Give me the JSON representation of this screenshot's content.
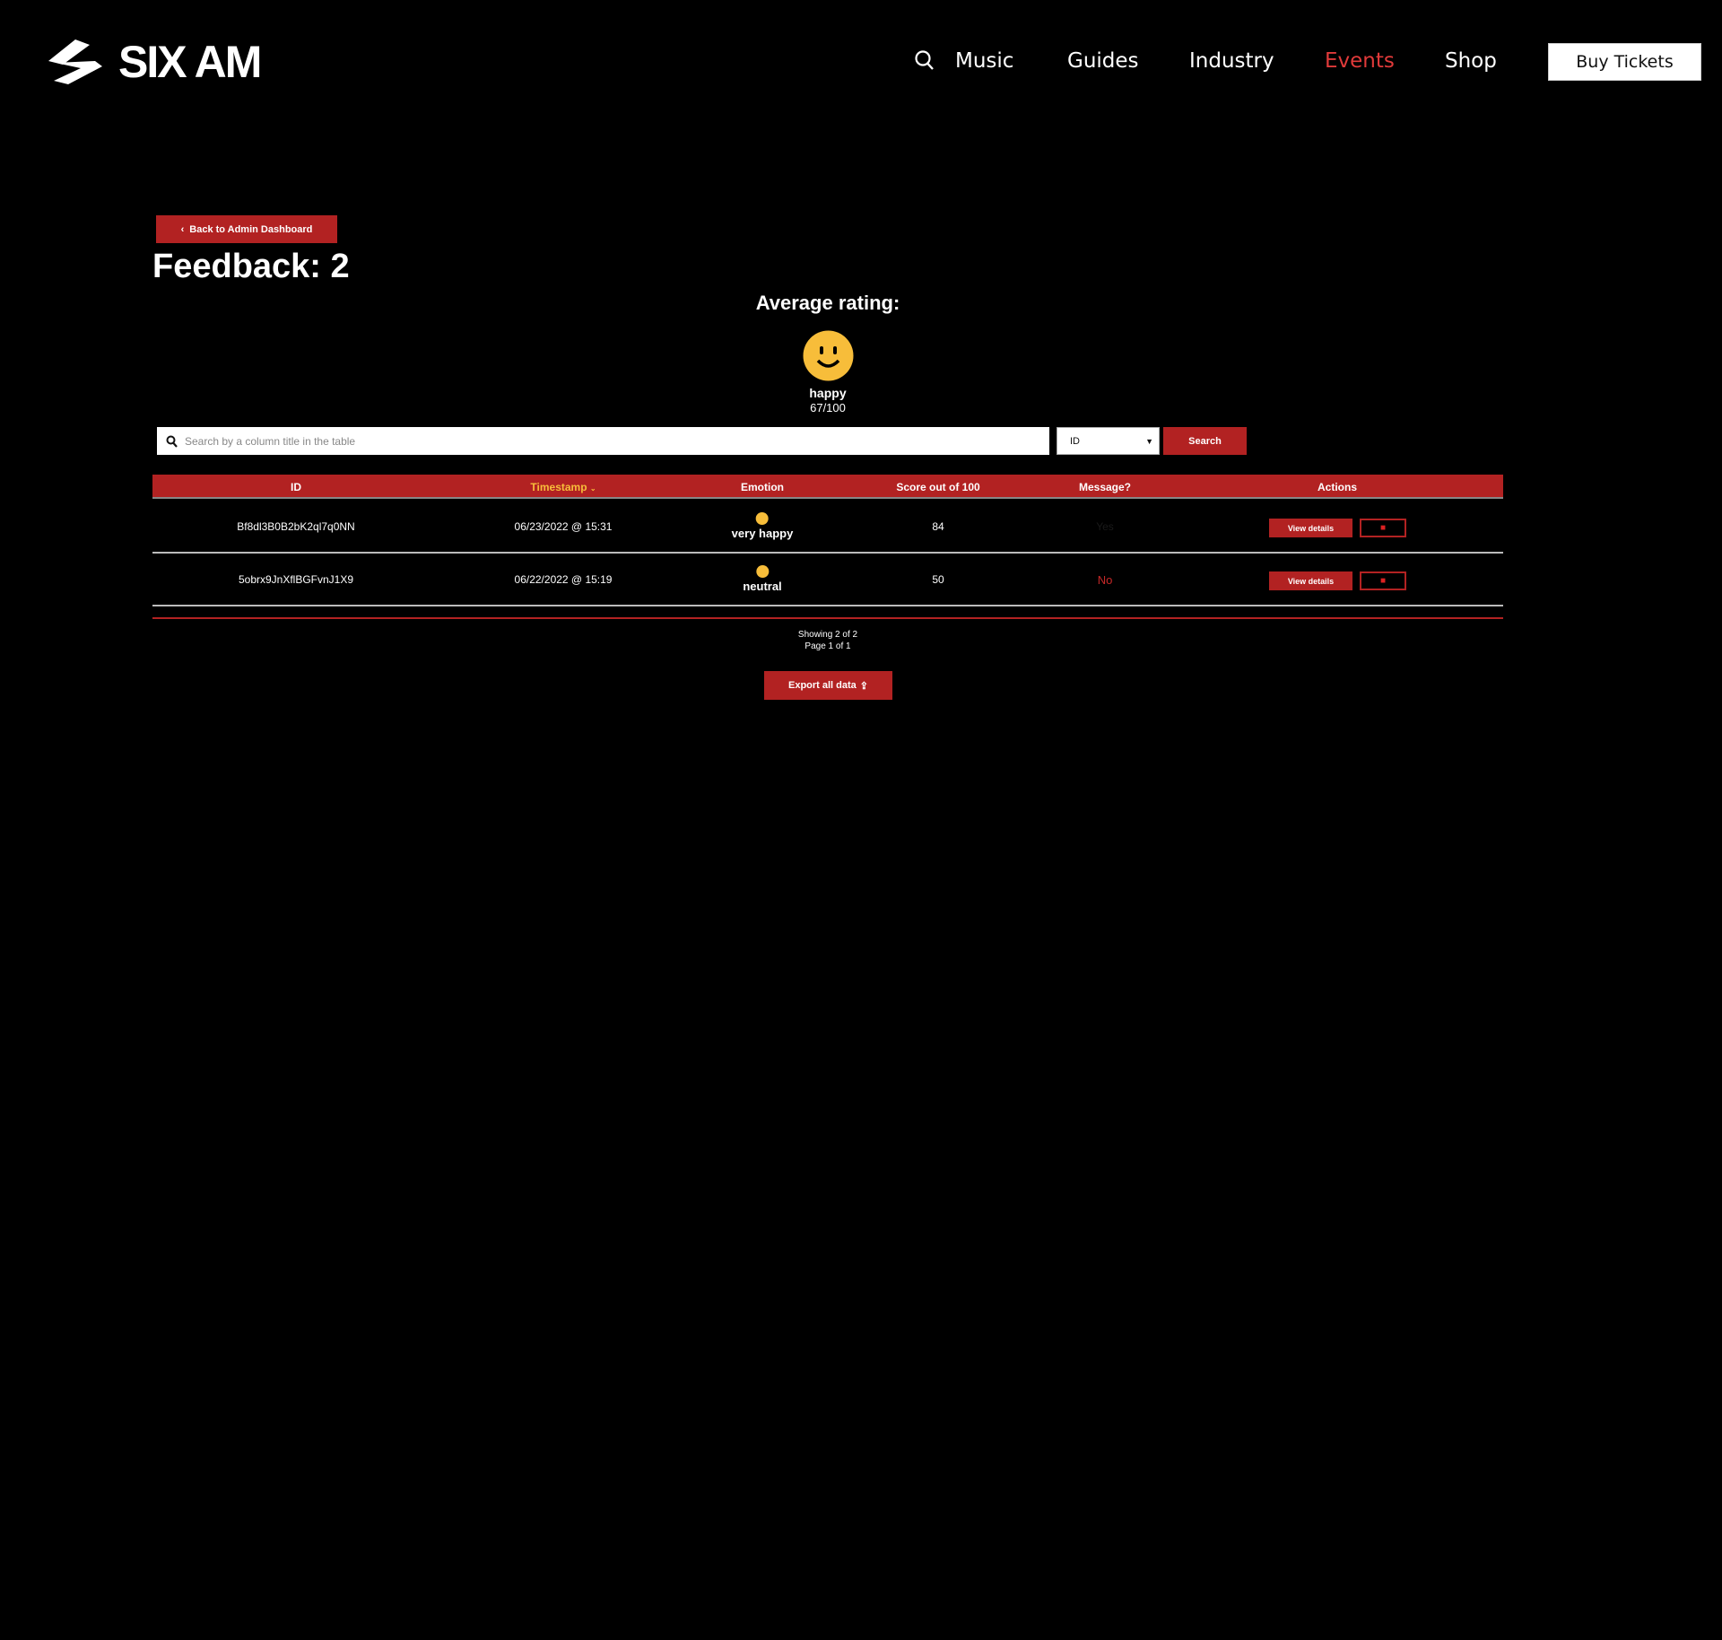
{
  "header": {
    "brand": "SIX AM",
    "nav": [
      "Music",
      "Guides",
      "Industry",
      "Events",
      "Shop"
    ],
    "active_nav": "Events",
    "active_color": "#e03a3a",
    "buy_tickets": "Buy Tickets"
  },
  "page": {
    "back_label": "Back to Admin Dashboard",
    "title": "Feedback: 2",
    "average_label": "Average rating:",
    "average_emotion": "happy",
    "average_score": "67/100",
    "accent": "#b22222"
  },
  "search": {
    "placeholder": "Search by a column title in the table",
    "value": "",
    "select_value": "ID",
    "button": "Search"
  },
  "table": {
    "columns": [
      "ID",
      "Timestamp",
      "Emotion",
      "Score out of 100",
      "Message?",
      "Actions"
    ],
    "sorted_column": "Timestamp",
    "rows": [
      {
        "id": "Bf8dl3B0B2bK2ql7q0NN",
        "timestamp": "06/23/2022 @ 15:31",
        "emotion": "very happy",
        "score": "84",
        "message": "Yes",
        "view": "View details"
      },
      {
        "id": "5obrx9JnXflBGFvnJ1X9",
        "timestamp": "06/22/2022 @ 15:19",
        "emotion": "neutral",
        "score": "50",
        "message": "No",
        "view": "View details"
      }
    ]
  },
  "footer": {
    "showing": "Showing 2 of 2",
    "page": "Page 1 of 1",
    "export": "Export all data"
  }
}
